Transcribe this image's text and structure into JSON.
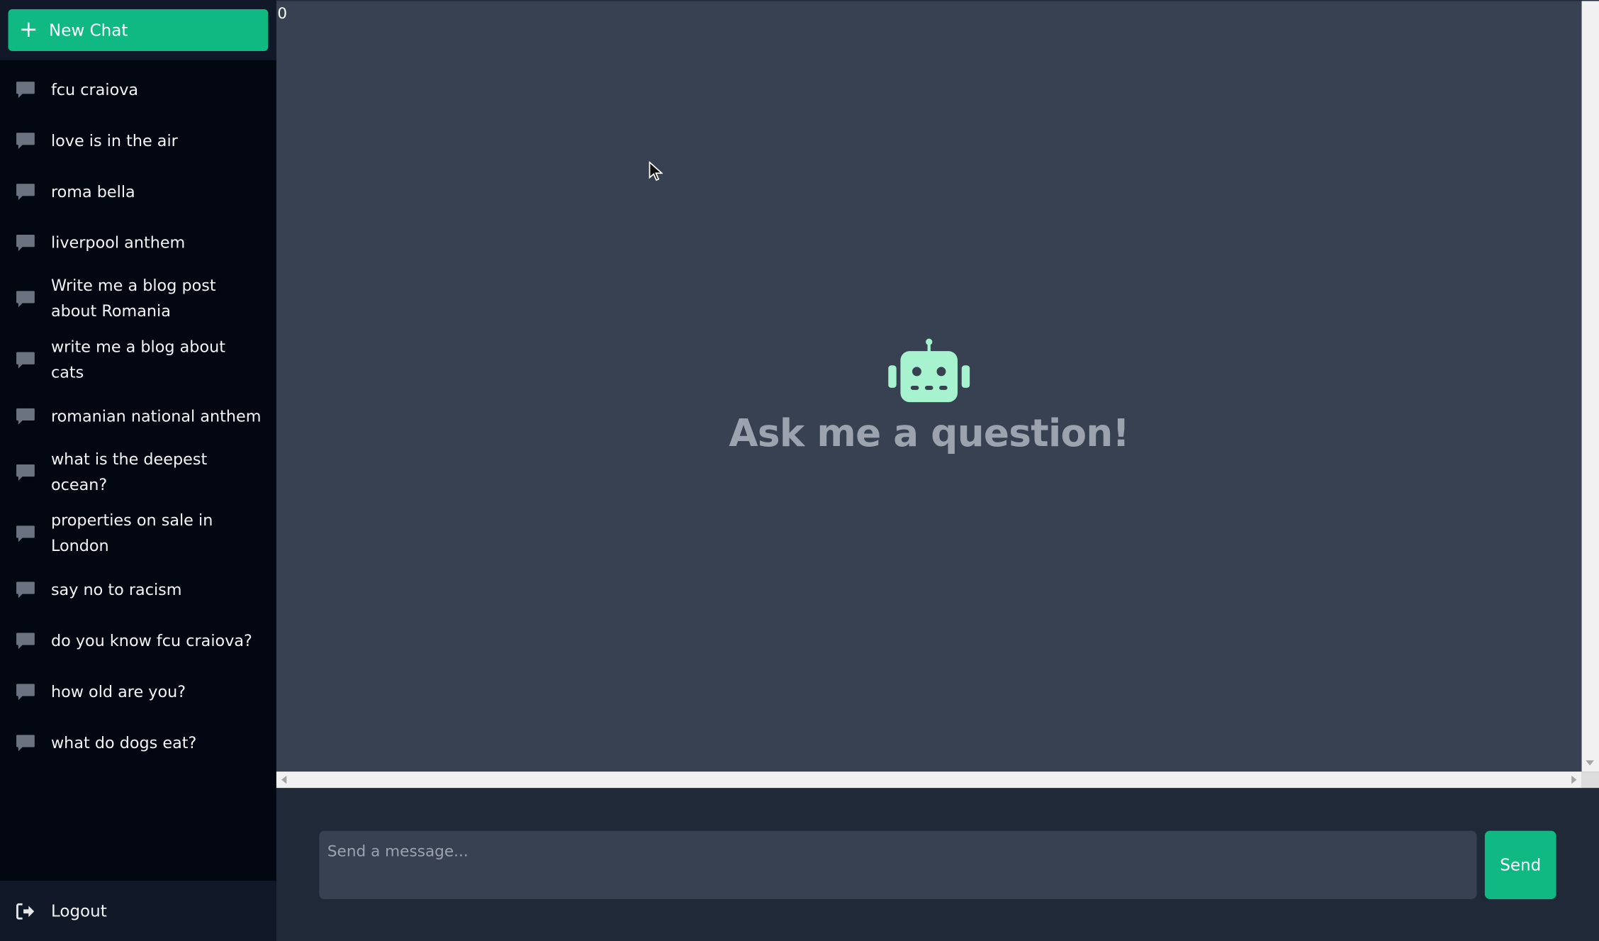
{
  "sidebar": {
    "new_chat_label": "New Chat",
    "chats": [
      {
        "label": "fcu craiova"
      },
      {
        "label": "love is in the air"
      },
      {
        "label": "roma bella"
      },
      {
        "label": "liverpool anthem"
      },
      {
        "label": "Write me a blog post about Romania"
      },
      {
        "label": "write me a blog about cats"
      },
      {
        "label": "romanian national anthem"
      },
      {
        "label": "what is the deepest ocean?"
      },
      {
        "label": "properties on sale in London"
      },
      {
        "label": "say no to racism"
      },
      {
        "label": "do you know fcu craiova?"
      },
      {
        "label": "how old are you?"
      },
      {
        "label": "what do dogs eat?"
      }
    ],
    "logout_label": "Logout"
  },
  "main": {
    "counter": "0",
    "empty_title": "Ask me a question!",
    "robot_icon": "robot-icon"
  },
  "composer": {
    "placeholder": "Send a message...",
    "value": "",
    "send_label": "Send"
  },
  "colors": {
    "accent": "#10b981",
    "robot": "#a7f3d0",
    "sidebar_bg": "#030712",
    "main_bg": "#374151",
    "footer_bg": "#1f2937"
  }
}
